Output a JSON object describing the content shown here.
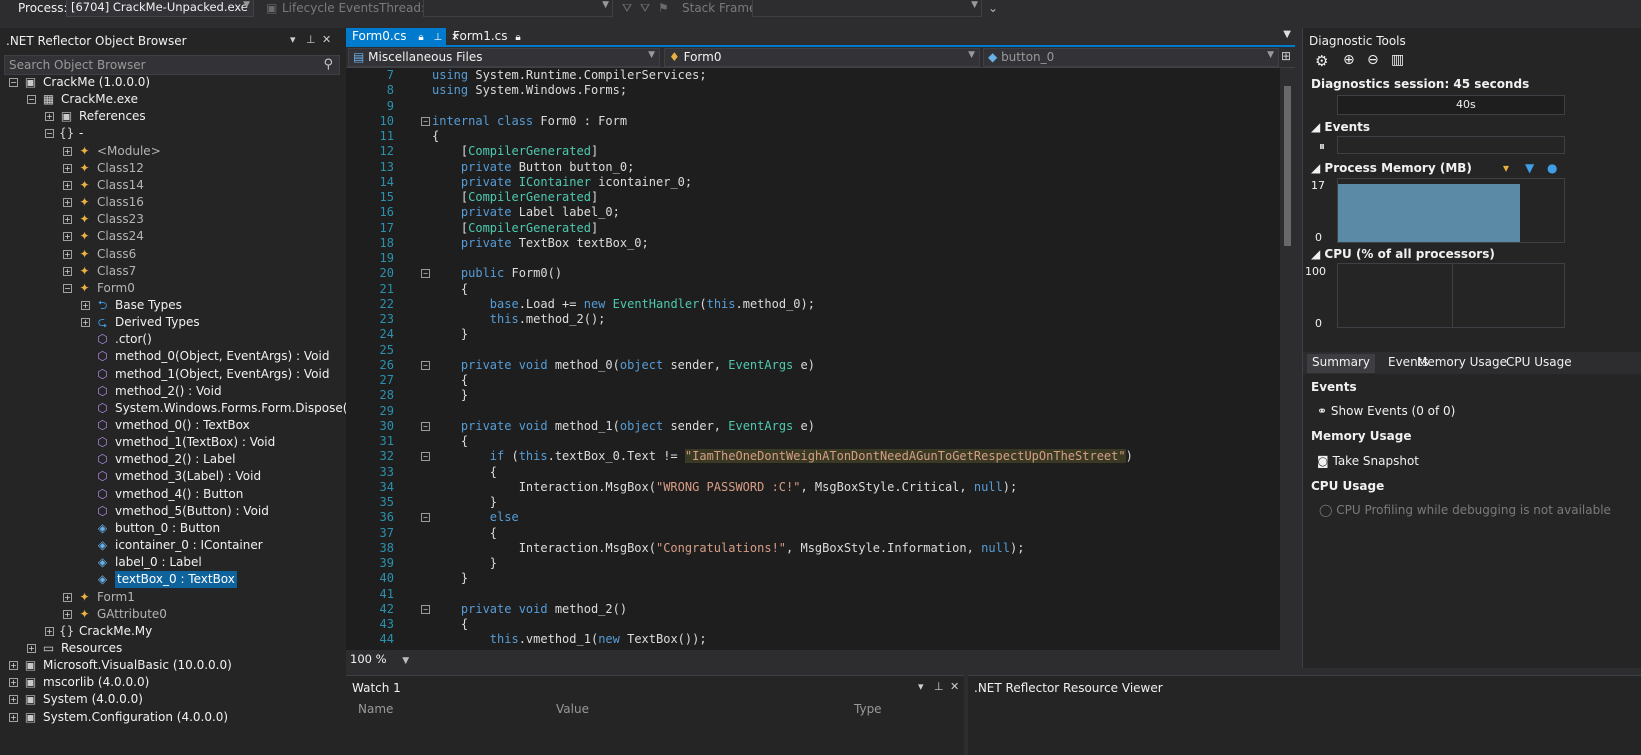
{
  "toolbar": {
    "process_label": "Process:",
    "process_value": "[6704] CrackMe-Unpacked.exe",
    "lifecycle_label": "Lifecycle Events",
    "thread_label": "Thread:",
    "stackframe_label": "Stack Frame:"
  },
  "object_browser": {
    "title": ".NET Reflector Object Browser",
    "search_placeholder": "Search Object Browser",
    "nodes": [
      {
        "label": "CrackMe (1.0.0.0)",
        "icon": "assembly-icon"
      },
      {
        "label": "CrackMe.exe",
        "icon": "module-icon"
      },
      {
        "label": "References",
        "icon": "references-icon"
      },
      {
        "label": "-",
        "icon": "namespace-icon"
      },
      {
        "label": "<Module>",
        "icon": "class-icon"
      },
      {
        "label": "Class12",
        "icon": "class-icon"
      },
      {
        "label": "Class14",
        "icon": "class-icon"
      },
      {
        "label": "Class16",
        "icon": "class-icon"
      },
      {
        "label": "Class23",
        "icon": "class-icon"
      },
      {
        "label": "Class24",
        "icon": "class-icon"
      },
      {
        "label": "Class6",
        "icon": "class-icon"
      },
      {
        "label": "Class7",
        "icon": "class-icon"
      },
      {
        "label": "Form0",
        "icon": "class-icon"
      },
      {
        "label": "Base Types",
        "icon": "base-types-icon"
      },
      {
        "label": "Derived Types",
        "icon": "derived-types-icon"
      },
      {
        "label": ".ctor()",
        "icon": "method-icon"
      },
      {
        "label": "method_0(Object, EventArgs) : Void",
        "icon": "method-icon"
      },
      {
        "label": "method_1(Object, EventArgs) : Void",
        "icon": "method-icon"
      },
      {
        "label": "method_2() : Void",
        "icon": "method-icon"
      },
      {
        "label": "System.Windows.Forms.Form.Dispose(Bool",
        "icon": "method-icon"
      },
      {
        "label": "vmethod_0() : TextBox",
        "icon": "method-icon"
      },
      {
        "label": "vmethod_1(TextBox) : Void",
        "icon": "method-icon"
      },
      {
        "label": "vmethod_2() : Label",
        "icon": "method-icon"
      },
      {
        "label": "vmethod_3(Label) : Void",
        "icon": "method-icon"
      },
      {
        "label": "vmethod_4() : Button",
        "icon": "method-icon"
      },
      {
        "label": "vmethod_5(Button) : Void",
        "icon": "method-icon"
      },
      {
        "label": "button_0 : Button",
        "icon": "field-icon"
      },
      {
        "label": "icontainer_0 : IContainer",
        "icon": "field-icon"
      },
      {
        "label": "label_0 : Label",
        "icon": "field-icon"
      },
      {
        "label": "textBox_0 : TextBox",
        "icon": "field-icon"
      },
      {
        "label": "Form1",
        "icon": "class-icon"
      },
      {
        "label": "GAttribute0",
        "icon": "class-icon"
      },
      {
        "label": "CrackMe.My",
        "icon": "namespace-icon"
      },
      {
        "label": "Resources",
        "icon": "folder-icon"
      },
      {
        "label": "Microsoft.VisualBasic (10.0.0.0)",
        "icon": "assembly-icon"
      },
      {
        "label": "mscorlib (4.0.0.0)",
        "icon": "assembly-icon"
      },
      {
        "label": "System (4.0.0.0)",
        "icon": "assembly-icon"
      },
      {
        "label": "System.Configuration (4.0.0.0)",
        "icon": "assembly-icon"
      }
    ]
  },
  "editor": {
    "tabs": [
      "Form0.cs",
      "Form1.cs"
    ],
    "nav_project": "Miscellaneous Files",
    "nav_class": "Form0",
    "nav_member": "button_0",
    "zoom": "100 %",
    "lines": [
      {
        "n": "7",
        "segs": [
          [
            "kw",
            "using"
          ],
          [
            "p",
            " System.Runtime.CompilerServices;"
          ]
        ]
      },
      {
        "n": "8",
        "segs": [
          [
            "kw",
            "using"
          ],
          [
            "p",
            " System.Windows.Forms;"
          ]
        ]
      },
      {
        "n": "9",
        "segs": []
      },
      {
        "n": "10",
        "segs": [
          [
            "kw",
            "internal class"
          ],
          [
            "p",
            " Form0 : Form"
          ]
        ]
      },
      {
        "n": "11",
        "segs": [
          [
            "p",
            "{"
          ]
        ]
      },
      {
        "n": "12",
        "segs": [
          [
            "p",
            "    ["
          ],
          [
            "ty",
            "CompilerGenerated"
          ],
          [
            "p",
            "]"
          ]
        ]
      },
      {
        "n": "13",
        "segs": [
          [
            "p",
            "    "
          ],
          [
            "kw",
            "private"
          ],
          [
            "p",
            " Button button_0;"
          ]
        ]
      },
      {
        "n": "14",
        "segs": [
          [
            "p",
            "    "
          ],
          [
            "kw",
            "private"
          ],
          [
            "p",
            " "
          ],
          [
            "ty",
            "IContainer"
          ],
          [
            "p",
            " icontainer_0;"
          ]
        ]
      },
      {
        "n": "15",
        "segs": [
          [
            "p",
            "    ["
          ],
          [
            "ty",
            "CompilerGenerated"
          ],
          [
            "p",
            "]"
          ]
        ]
      },
      {
        "n": "16",
        "segs": [
          [
            "p",
            "    "
          ],
          [
            "kw",
            "private"
          ],
          [
            "p",
            " Label label_0;"
          ]
        ]
      },
      {
        "n": "17",
        "segs": [
          [
            "p",
            "    ["
          ],
          [
            "ty",
            "CompilerGenerated"
          ],
          [
            "p",
            "]"
          ]
        ]
      },
      {
        "n": "18",
        "segs": [
          [
            "p",
            "    "
          ],
          [
            "kw",
            "private"
          ],
          [
            "p",
            " TextBox textBox_0;"
          ]
        ]
      },
      {
        "n": "19",
        "segs": []
      },
      {
        "n": "20",
        "segs": [
          [
            "p",
            "    "
          ],
          [
            "kw",
            "public"
          ],
          [
            "p",
            " Form0()"
          ]
        ]
      },
      {
        "n": "21",
        "segs": [
          [
            "p",
            "    {"
          ]
        ]
      },
      {
        "n": "22",
        "segs": [
          [
            "p",
            "        "
          ],
          [
            "kw",
            "base"
          ],
          [
            "p",
            ".Load += "
          ],
          [
            "kw",
            "new"
          ],
          [
            "p",
            " "
          ],
          [
            "ty",
            "EventHandler"
          ],
          [
            "p",
            "("
          ],
          [
            "kw",
            "this"
          ],
          [
            "p",
            ".method_0);"
          ]
        ]
      },
      {
        "n": "23",
        "segs": [
          [
            "p",
            "        "
          ],
          [
            "kw",
            "this"
          ],
          [
            "p",
            ".method_2();"
          ]
        ]
      },
      {
        "n": "24",
        "segs": [
          [
            "p",
            "    }"
          ]
        ]
      },
      {
        "n": "25",
        "segs": []
      },
      {
        "n": "26",
        "segs": [
          [
            "p",
            "    "
          ],
          [
            "kw",
            "private void"
          ],
          [
            "p",
            " method_0("
          ],
          [
            "kw",
            "object"
          ],
          [
            "p",
            " sender, "
          ],
          [
            "ty",
            "EventArgs"
          ],
          [
            "p",
            " e)"
          ]
        ]
      },
      {
        "n": "27",
        "segs": [
          [
            "p",
            "    {"
          ]
        ]
      },
      {
        "n": "28",
        "segs": [
          [
            "p",
            "    }"
          ]
        ]
      },
      {
        "n": "29",
        "segs": []
      },
      {
        "n": "30",
        "segs": [
          [
            "p",
            "    "
          ],
          [
            "kw",
            "private void"
          ],
          [
            "p",
            " method_1("
          ],
          [
            "kw",
            "object"
          ],
          [
            "p",
            " sender, "
          ],
          [
            "ty",
            "EventArgs"
          ],
          [
            "p",
            " e)"
          ]
        ]
      },
      {
        "n": "31",
        "segs": [
          [
            "p",
            "    {"
          ]
        ]
      },
      {
        "n": "32",
        "segs": [
          [
            "p",
            "        "
          ],
          [
            "kw",
            "if"
          ],
          [
            "p",
            " ("
          ],
          [
            "kw",
            "this"
          ],
          [
            "p",
            ".textBox_0.Text != "
          ],
          [
            "sthl",
            "\"IamTheOneDontWeighATonDontNeedAGunToGetRespectUpOnTheStreet\""
          ],
          [
            "p",
            ")"
          ]
        ]
      },
      {
        "n": "33",
        "segs": [
          [
            "p",
            "        {"
          ]
        ]
      },
      {
        "n": "34",
        "segs": [
          [
            "p",
            "            Interaction.MsgBox("
          ],
          [
            "st",
            "\"WRONG PASSWORD :C!\""
          ],
          [
            "p",
            ", MsgBoxStyle.Critical, "
          ],
          [
            "kw",
            "null"
          ],
          [
            "p",
            ");"
          ]
        ]
      },
      {
        "n": "35",
        "segs": [
          [
            "p",
            "        }"
          ]
        ]
      },
      {
        "n": "36",
        "segs": [
          [
            "p",
            "        "
          ],
          [
            "kw",
            "else"
          ]
        ]
      },
      {
        "n": "37",
        "segs": [
          [
            "p",
            "        {"
          ]
        ]
      },
      {
        "n": "38",
        "segs": [
          [
            "p",
            "            Interaction.MsgBox("
          ],
          [
            "st",
            "\"Congratulations!\""
          ],
          [
            "p",
            ", MsgBoxStyle.Information, "
          ],
          [
            "kw",
            "null"
          ],
          [
            "p",
            ");"
          ]
        ]
      },
      {
        "n": "39",
        "segs": [
          [
            "p",
            "        }"
          ]
        ]
      },
      {
        "n": "40",
        "segs": [
          [
            "p",
            "    }"
          ]
        ]
      },
      {
        "n": "41",
        "segs": []
      },
      {
        "n": "42",
        "segs": [
          [
            "p",
            "    "
          ],
          [
            "kw",
            "private void"
          ],
          [
            "p",
            " method_2()"
          ]
        ]
      },
      {
        "n": "43",
        "segs": [
          [
            "p",
            "    {"
          ]
        ]
      },
      {
        "n": "44",
        "segs": [
          [
            "p",
            "        "
          ],
          [
            "kw",
            "this"
          ],
          [
            "p",
            ".vmethod_1("
          ],
          [
            "kw",
            "new"
          ],
          [
            "p",
            " TextBox());"
          ]
        ]
      }
    ]
  },
  "diagnostics": {
    "title": "Diagnostic Tools",
    "session": "Diagnostics session: 45 seconds",
    "timeline_mark": "40s",
    "events_section": "Events",
    "memory_section": "Process Memory (MB)",
    "memory_max": "17",
    "memory_min": "0",
    "memory_level": 0.92,
    "cpu_section": "CPU (% of all processors)",
    "cpu_max": "100",
    "cpu_min": "0",
    "tabs": [
      "Summary",
      "Events",
      "Memory Usage",
      "CPU Usage"
    ],
    "summary_events_heading": "Events",
    "show_events": "Show Events (0 of 0)",
    "memory_usage_heading": "Memory Usage",
    "take_snapshot": "Take Snapshot",
    "cpu_usage_heading": "CPU Usage",
    "cpu_profiling_note": "CPU Profiling while debugging is not available"
  },
  "watch": {
    "title": "Watch 1",
    "columns": [
      "Name",
      "Value",
      "Type"
    ]
  },
  "resource_viewer": {
    "title": ".NET Reflector Resource Viewer"
  },
  "colors": {
    "accent": "#007acc",
    "background": "#1e1e1e",
    "keyword": "#569cd6",
    "type": "#4ec9b0",
    "string": "#d69d85"
  }
}
